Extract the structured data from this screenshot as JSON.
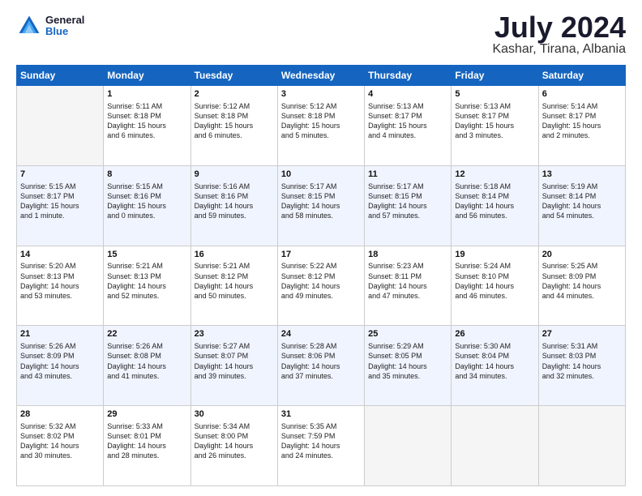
{
  "header": {
    "logo": {
      "general": "General",
      "blue": "Blue"
    },
    "title": "July 2024",
    "subtitle": "Kashar, Tirana, Albania"
  },
  "calendar": {
    "headers": [
      "Sunday",
      "Monday",
      "Tuesday",
      "Wednesday",
      "Thursday",
      "Friday",
      "Saturday"
    ],
    "weeks": [
      [
        {
          "day": "",
          "info": ""
        },
        {
          "day": "1",
          "info": "Sunrise: 5:11 AM\nSunset: 8:18 PM\nDaylight: 15 hours\nand 6 minutes."
        },
        {
          "day": "2",
          "info": "Sunrise: 5:12 AM\nSunset: 8:18 PM\nDaylight: 15 hours\nand 6 minutes."
        },
        {
          "day": "3",
          "info": "Sunrise: 5:12 AM\nSunset: 8:18 PM\nDaylight: 15 hours\nand 5 minutes."
        },
        {
          "day": "4",
          "info": "Sunrise: 5:13 AM\nSunset: 8:17 PM\nDaylight: 15 hours\nand 4 minutes."
        },
        {
          "day": "5",
          "info": "Sunrise: 5:13 AM\nSunset: 8:17 PM\nDaylight: 15 hours\nand 3 minutes."
        },
        {
          "day": "6",
          "info": "Sunrise: 5:14 AM\nSunset: 8:17 PM\nDaylight: 15 hours\nand 2 minutes."
        }
      ],
      [
        {
          "day": "7",
          "info": "Sunrise: 5:15 AM\nSunset: 8:17 PM\nDaylight: 15 hours\nand 1 minute."
        },
        {
          "day": "8",
          "info": "Sunrise: 5:15 AM\nSunset: 8:16 PM\nDaylight: 15 hours\nand 0 minutes."
        },
        {
          "day": "9",
          "info": "Sunrise: 5:16 AM\nSunset: 8:16 PM\nDaylight: 14 hours\nand 59 minutes."
        },
        {
          "day": "10",
          "info": "Sunrise: 5:17 AM\nSunset: 8:15 PM\nDaylight: 14 hours\nand 58 minutes."
        },
        {
          "day": "11",
          "info": "Sunrise: 5:17 AM\nSunset: 8:15 PM\nDaylight: 14 hours\nand 57 minutes."
        },
        {
          "day": "12",
          "info": "Sunrise: 5:18 AM\nSunset: 8:14 PM\nDaylight: 14 hours\nand 56 minutes."
        },
        {
          "day": "13",
          "info": "Sunrise: 5:19 AM\nSunset: 8:14 PM\nDaylight: 14 hours\nand 54 minutes."
        }
      ],
      [
        {
          "day": "14",
          "info": "Sunrise: 5:20 AM\nSunset: 8:13 PM\nDaylight: 14 hours\nand 53 minutes."
        },
        {
          "day": "15",
          "info": "Sunrise: 5:21 AM\nSunset: 8:13 PM\nDaylight: 14 hours\nand 52 minutes."
        },
        {
          "day": "16",
          "info": "Sunrise: 5:21 AM\nSunset: 8:12 PM\nDaylight: 14 hours\nand 50 minutes."
        },
        {
          "day": "17",
          "info": "Sunrise: 5:22 AM\nSunset: 8:12 PM\nDaylight: 14 hours\nand 49 minutes."
        },
        {
          "day": "18",
          "info": "Sunrise: 5:23 AM\nSunset: 8:11 PM\nDaylight: 14 hours\nand 47 minutes."
        },
        {
          "day": "19",
          "info": "Sunrise: 5:24 AM\nSunset: 8:10 PM\nDaylight: 14 hours\nand 46 minutes."
        },
        {
          "day": "20",
          "info": "Sunrise: 5:25 AM\nSunset: 8:09 PM\nDaylight: 14 hours\nand 44 minutes."
        }
      ],
      [
        {
          "day": "21",
          "info": "Sunrise: 5:26 AM\nSunset: 8:09 PM\nDaylight: 14 hours\nand 43 minutes."
        },
        {
          "day": "22",
          "info": "Sunrise: 5:26 AM\nSunset: 8:08 PM\nDaylight: 14 hours\nand 41 minutes."
        },
        {
          "day": "23",
          "info": "Sunrise: 5:27 AM\nSunset: 8:07 PM\nDaylight: 14 hours\nand 39 minutes."
        },
        {
          "day": "24",
          "info": "Sunrise: 5:28 AM\nSunset: 8:06 PM\nDaylight: 14 hours\nand 37 minutes."
        },
        {
          "day": "25",
          "info": "Sunrise: 5:29 AM\nSunset: 8:05 PM\nDaylight: 14 hours\nand 35 minutes."
        },
        {
          "day": "26",
          "info": "Sunrise: 5:30 AM\nSunset: 8:04 PM\nDaylight: 14 hours\nand 34 minutes."
        },
        {
          "day": "27",
          "info": "Sunrise: 5:31 AM\nSunset: 8:03 PM\nDaylight: 14 hours\nand 32 minutes."
        }
      ],
      [
        {
          "day": "28",
          "info": "Sunrise: 5:32 AM\nSunset: 8:02 PM\nDaylight: 14 hours\nand 30 minutes."
        },
        {
          "day": "29",
          "info": "Sunrise: 5:33 AM\nSunset: 8:01 PM\nDaylight: 14 hours\nand 28 minutes."
        },
        {
          "day": "30",
          "info": "Sunrise: 5:34 AM\nSunset: 8:00 PM\nDaylight: 14 hours\nand 26 minutes."
        },
        {
          "day": "31",
          "info": "Sunrise: 5:35 AM\nSunset: 7:59 PM\nDaylight: 14 hours\nand 24 minutes."
        },
        {
          "day": "",
          "info": ""
        },
        {
          "day": "",
          "info": ""
        },
        {
          "day": "",
          "info": ""
        }
      ]
    ]
  }
}
